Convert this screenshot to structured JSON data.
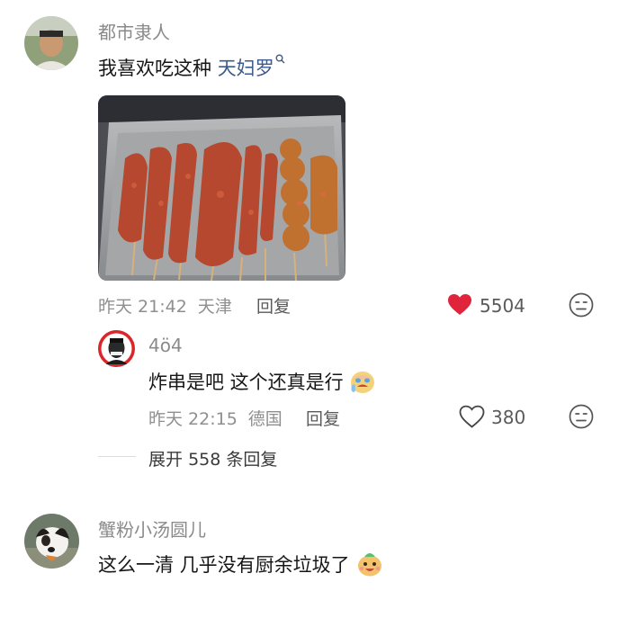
{
  "comments": [
    {
      "username": "都市隶人",
      "text_prefix": "我喜欢吃这种 ",
      "link": "天妇罗",
      "time": "昨天 21:42",
      "location": "天津",
      "reply_label": "回复",
      "likes": "5504",
      "image_desc": "skewers"
    },
    {
      "username": "蟹粉小汤圆儿",
      "text": "这么一清 几乎没有厨余垃圾了"
    }
  ],
  "reply": {
    "username": "4ö4",
    "text": "炸串是吧 这个还真是行",
    "time": "昨天 22:15",
    "location": "德国",
    "reply_label": "回复",
    "likes": "380"
  },
  "expand": {
    "prefix": "展开",
    "count": "558",
    "suffix": "条回复"
  },
  "icons": {
    "liked_heart": "heart-filled-icon",
    "heart": "heart-outline-icon",
    "dislike": "dislike-face-icon",
    "search": "search-icon"
  },
  "colors": {
    "like_red": "#e0243b",
    "link_blue": "#3b5b8f"
  }
}
